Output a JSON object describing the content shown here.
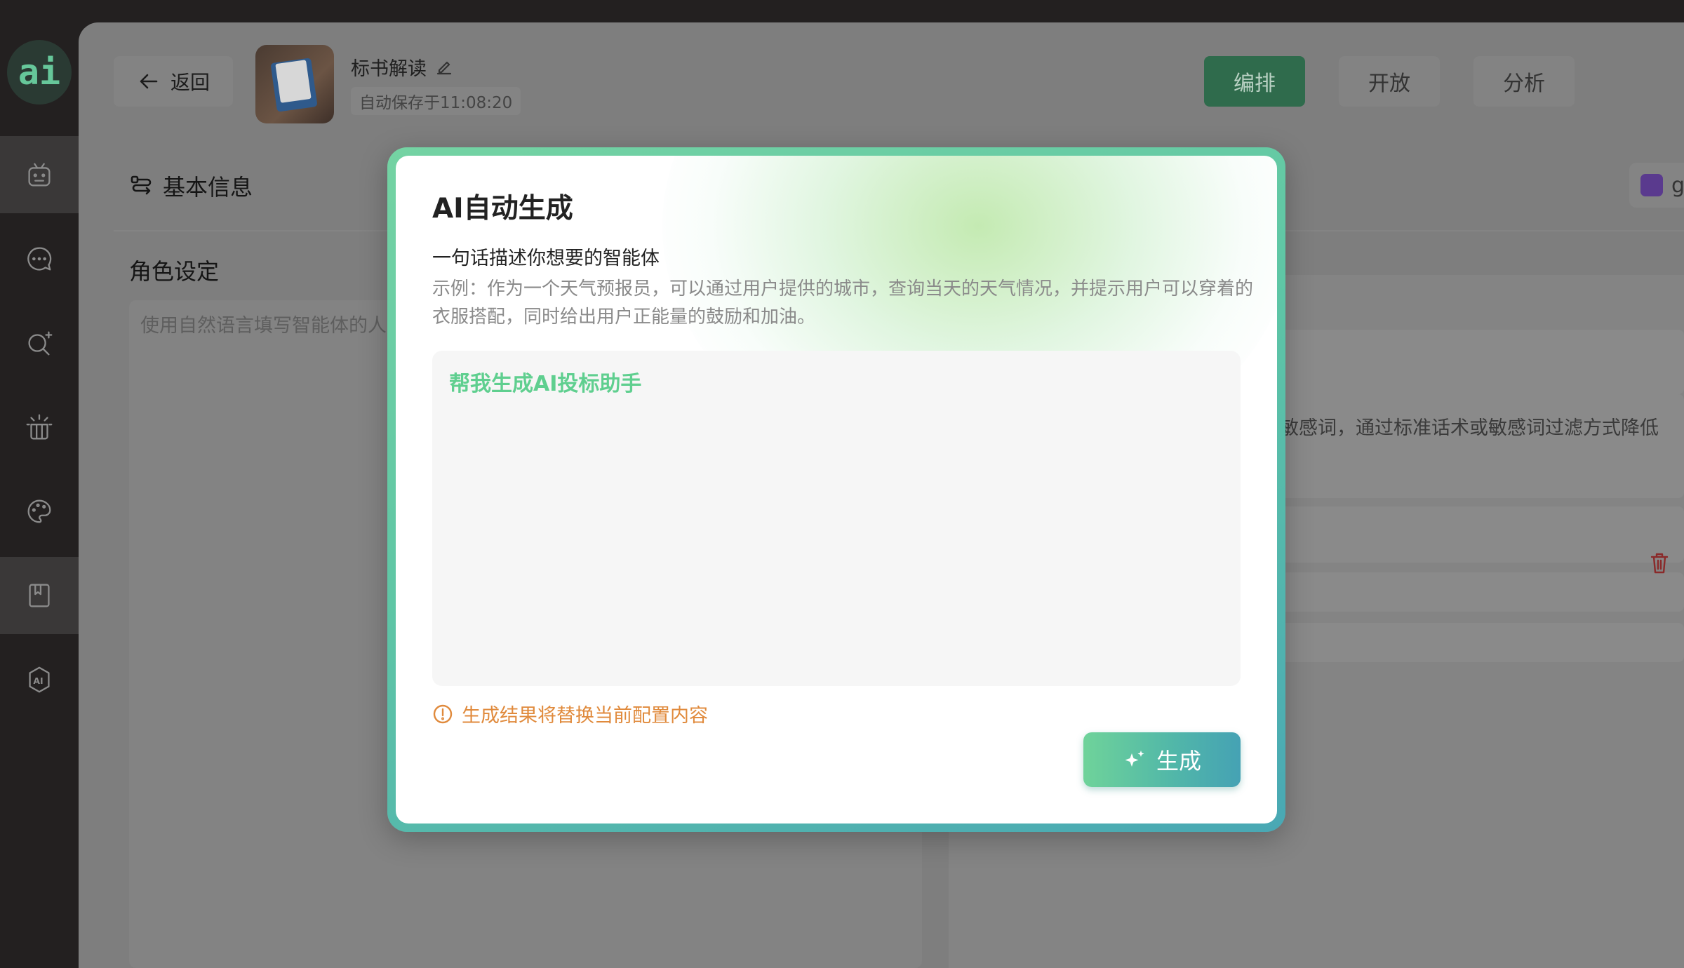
{
  "sidebar": {
    "logo_text": "ai",
    "items": [
      {
        "icon": "robot-icon"
      },
      {
        "icon": "chat-icon"
      },
      {
        "icon": "search-sparkle-icon"
      },
      {
        "icon": "idea-icon"
      },
      {
        "icon": "palette-icon"
      },
      {
        "icon": "book-icon"
      },
      {
        "icon": "ai-badge-icon"
      }
    ],
    "active_indices": [
      0,
      5
    ]
  },
  "header": {
    "back_label": "返回",
    "app_name": "标书解读",
    "autosave_text": "自动保存于11:08:20",
    "tabs": [
      {
        "label": "编排",
        "active": true
      },
      {
        "label": "开放",
        "active": false
      },
      {
        "label": "分析",
        "active": false
      }
    ]
  },
  "content": {
    "section_title": "基本信息",
    "role_title": "角色设定",
    "role_placeholder": "使用自然语言填写智能体的人",
    "right_snippet": "敏感词，通过标准话术或敏感词过滤方式降低",
    "model_chip": "gp"
  },
  "modal": {
    "title": "AI自动生成",
    "subtitle": "一句话描述你想要的智能体",
    "example": "示例：作为一个天气预报员，可以通过用户提供的城市，查询当天的天气情况，并提示用户可以穿着的衣服搭配，同时给出用户正能量的鼓励和加油。",
    "prompt_value": "帮我生成AI投标助手",
    "warning": "生成结果将替换当前配置内容",
    "generate_label": "生成"
  },
  "colors": {
    "accent_green": "#5fcf8f",
    "gradient_end": "#45a2b4",
    "warning": "#e08a3c",
    "active_tab": "#2f6b4c"
  }
}
